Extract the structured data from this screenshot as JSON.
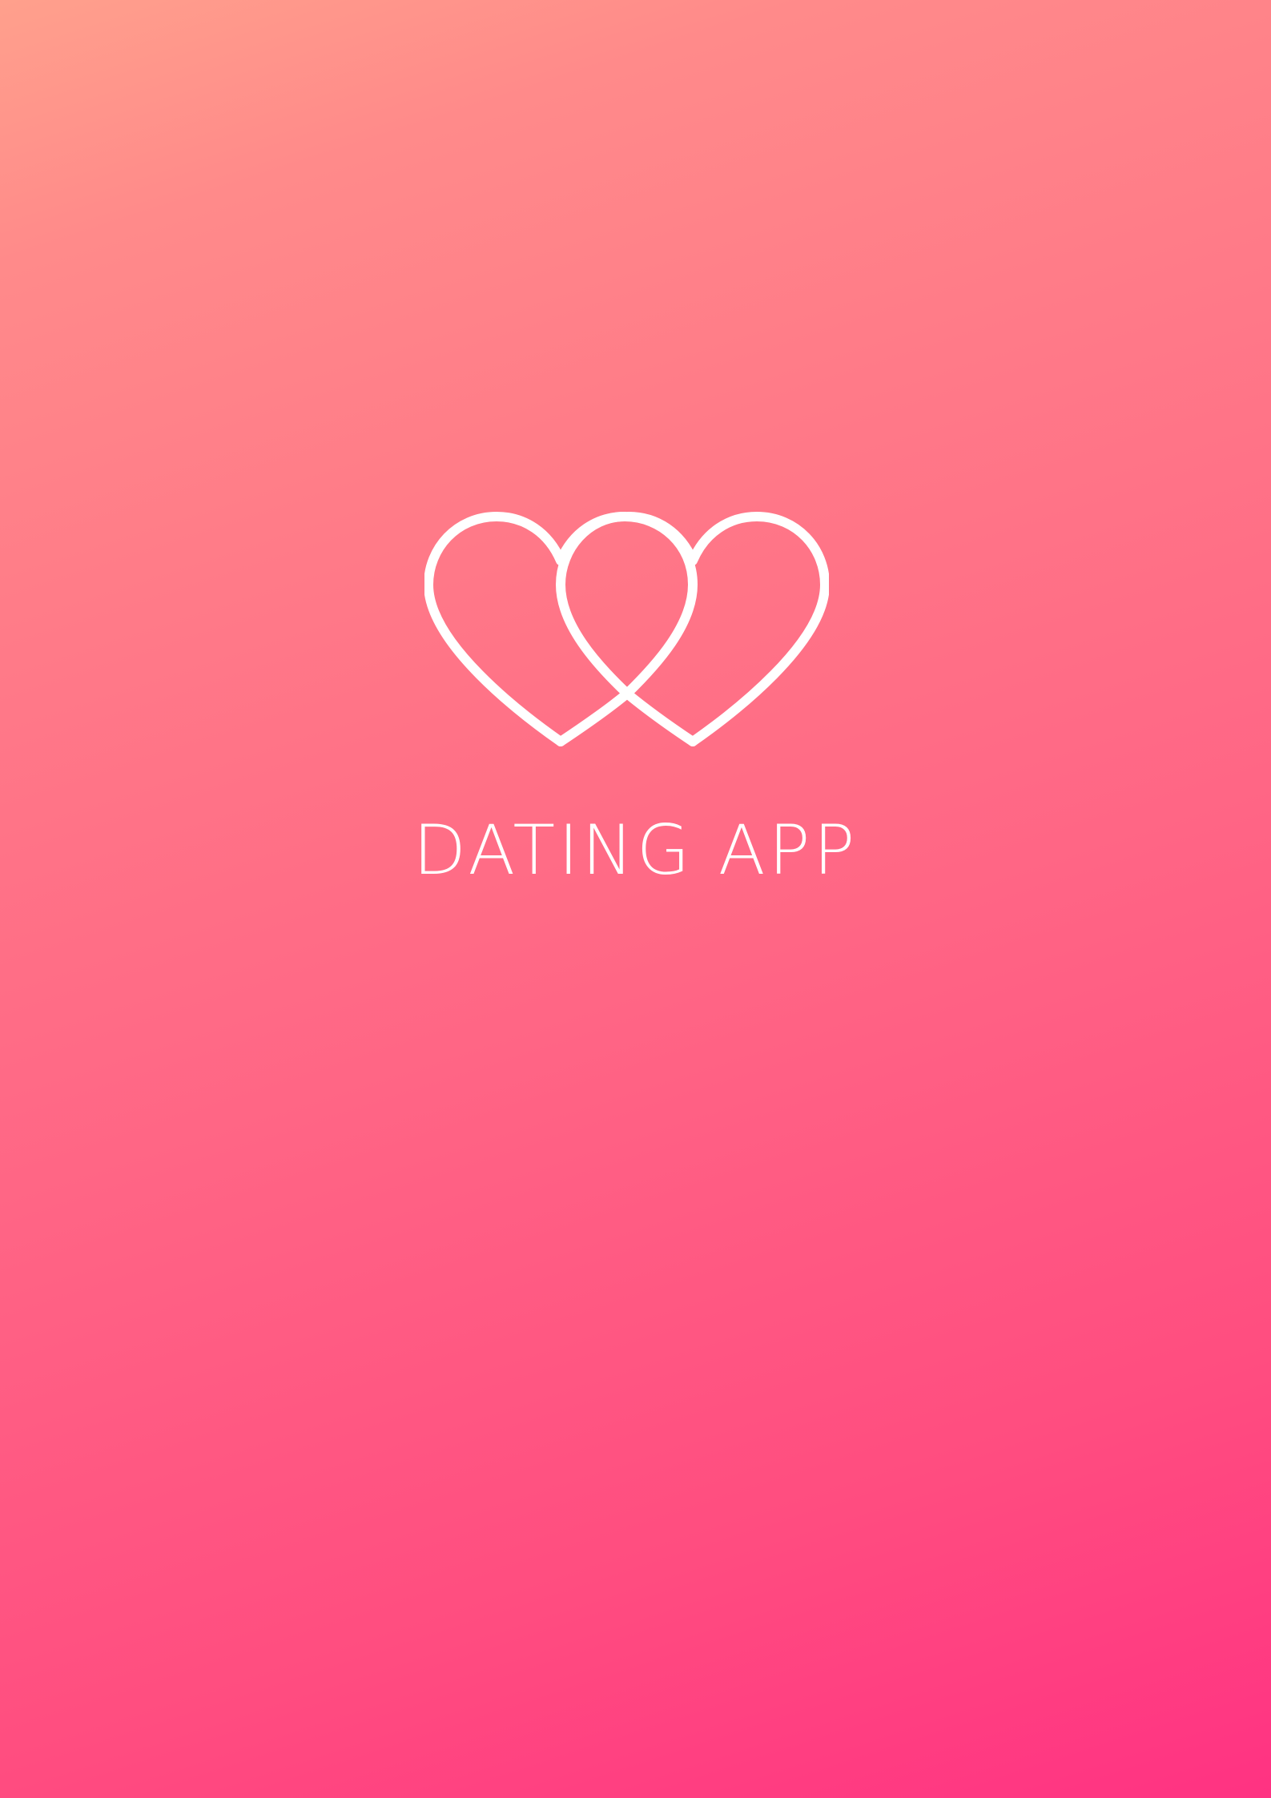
{
  "app": {
    "name": "DATING APP"
  },
  "logo": {
    "icon": "double-heart-outline-icon",
    "color": "#ffffff"
  },
  "background": {
    "gradient_start": "#ffa08c",
    "gradient_end": "#ff3282"
  }
}
